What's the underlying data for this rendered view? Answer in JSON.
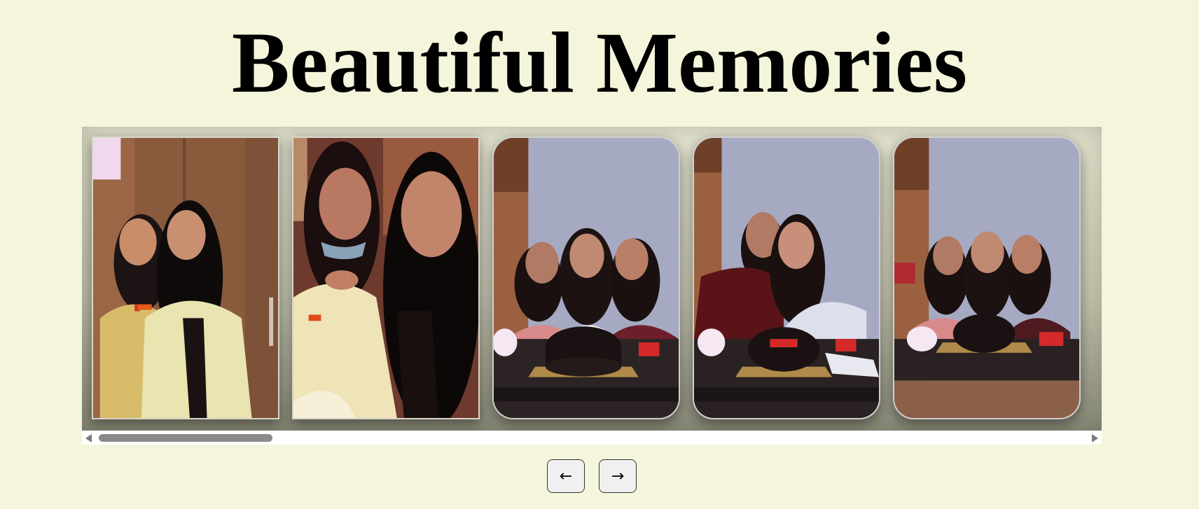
{
  "header": {
    "title": "Beautiful Memories"
  },
  "gallery": {
    "photos": [
      {
        "name": "photo-two-friends-wardrobe",
        "style": "square"
      },
      {
        "name": "photo-two-friends-selfie",
        "style": "square"
      },
      {
        "name": "photo-three-friends-cake",
        "style": "rounded"
      },
      {
        "name": "photo-two-friends-cake",
        "style": "rounded"
      },
      {
        "name": "photo-three-friends-heart-gesture",
        "style": "rounded"
      }
    ],
    "scroll_fraction": 0.17
  },
  "controls": {
    "prev_icon": "arrow-left-icon",
    "next_icon": "arrow-right-icon",
    "prev_glyph": "←",
    "next_glyph": "→"
  },
  "colors": {
    "background": "#f5f5dc",
    "scrollbar_thumb": "#8a8a8a"
  }
}
